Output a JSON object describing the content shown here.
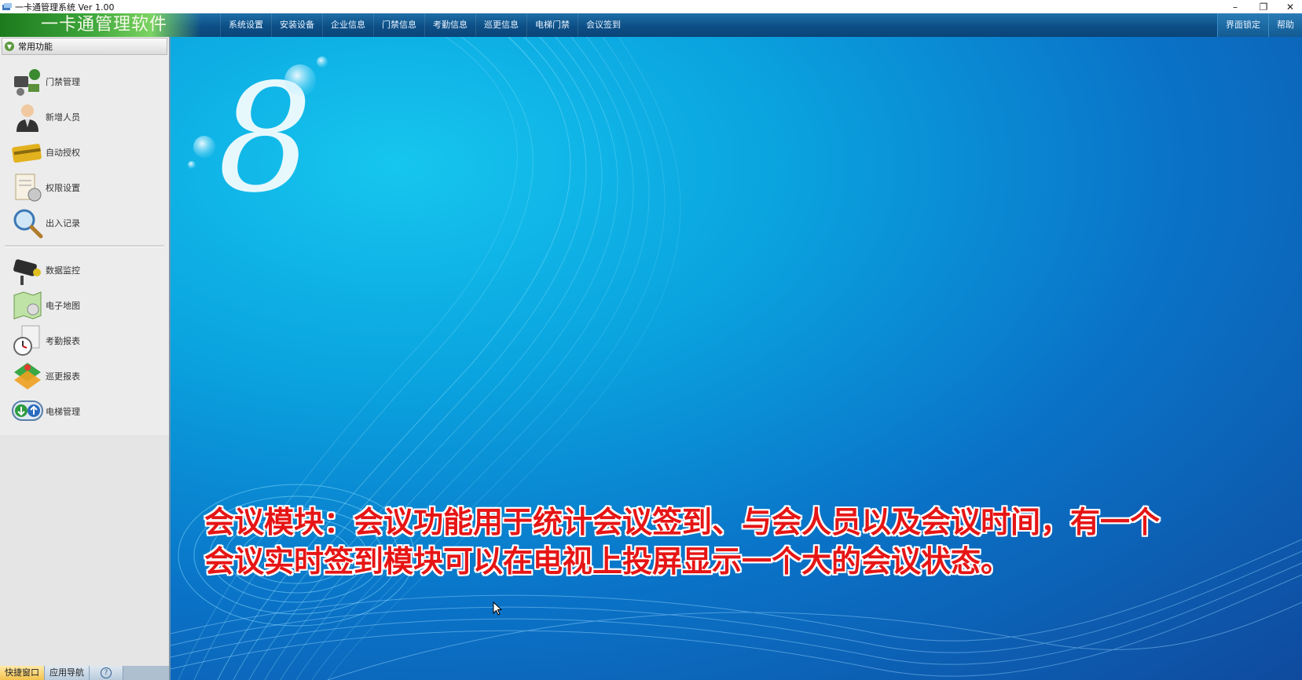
{
  "window": {
    "title": "一卡通管理系统  Ver 1.00",
    "minimize": "–",
    "restore": "❐",
    "close": "✕"
  },
  "menubar": {
    "brand": "一卡通管理软件",
    "items": [
      "系统设置",
      "安装设备",
      "企业信息",
      "门禁信息",
      "考勤信息",
      "巡更信息",
      "电梯门禁",
      "会议签到"
    ],
    "right_items": [
      "界面锁定",
      "帮助"
    ]
  },
  "sidebar": {
    "header": "常用功能",
    "group1": [
      {
        "label": "门禁管理",
        "icon": "door-access-icon"
      },
      {
        "label": "新增人员",
        "icon": "person-icon"
      },
      {
        "label": "自动授权",
        "icon": "card-icon"
      },
      {
        "label": "权限设置",
        "icon": "document-icon"
      },
      {
        "label": "出入记录",
        "icon": "magnifier-icon"
      }
    ],
    "group2": [
      {
        "label": "数据监控",
        "icon": "camera-icon"
      },
      {
        "label": "电子地图",
        "icon": "map-icon"
      },
      {
        "label": "考勤报表",
        "icon": "clock-icon"
      },
      {
        "label": "巡更报表",
        "icon": "patrol-icon"
      },
      {
        "label": "电梯管理",
        "icon": "elevator-icon"
      }
    ]
  },
  "bottom_tabs": {
    "quick_window": "快捷窗口",
    "app_nav": "应用导航",
    "help": "?"
  },
  "main": {
    "caption_line1": "会议模块：会议功能用于统计会议签到、与会人员以及会议时间，有一个",
    "caption_line2": "会议实时签到模块可以在电视上投屏显示一个大的会议状态。"
  },
  "colors": {
    "menubar": "#0d4f86",
    "brand_green": "#3da63b",
    "sidebar": "#ececec",
    "caption_red": "#e61515",
    "active_tab": "#f4c24d"
  }
}
